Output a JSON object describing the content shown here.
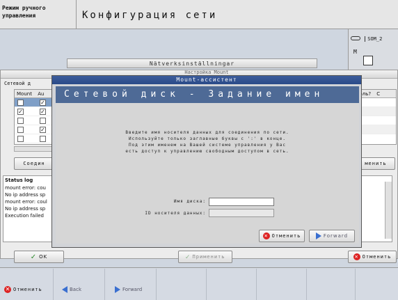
{
  "header": {
    "mode_label": "Режим ручного\nуправления",
    "title": "Конфигурация сети",
    "som_label": "SOM_2",
    "m_label": "M"
  },
  "bg_window": {
    "title": "Nätverksinställningar",
    "group_label": "Сетевой д",
    "table_headers": [
      "Mount",
      "Au"
    ],
    "rows_checked": [
      [
        false,
        true
      ],
      [
        true,
        true
      ],
      [
        false,
        false
      ],
      [
        false,
        true
      ],
      [
        false,
        false
      ]
    ],
    "connect_button": "Соедин",
    "right_header": "роль?",
    "right_header2": "C",
    "change_button": "менить",
    "status_title": "Status log",
    "status_lines": [
      "mount error: cou",
      "No ip address sp",
      "mount error: coul",
      "No ip address sp",
      "Execution failed"
    ],
    "ok_button": "OK",
    "apply_button": "Применить",
    "cancel_button": "Отменить"
  },
  "mount_window": {
    "behind_title": "Настройка Mount",
    "title": "Mount-ассистент",
    "header": "Сетевой диск - Задание имен",
    "info_text": "Введите имя носителя данных для соединения по сети.\nИспользуйте только заглавные буквы с ':' в конце.\nПод этим именем на Вашей системе управления у Вас\nесть доступ к управлению свободным доступом в сеть.",
    "disk_name_label": "Имя диска:",
    "disk_name_value": "",
    "data_carrier_label": "ID носителя данных:",
    "data_carrier_value": "",
    "cancel_button": "Отменить",
    "forward_button": "Forward"
  },
  "bottom_bar": {
    "cancel": "Отменить",
    "back": "Back",
    "forward": "Forward"
  }
}
